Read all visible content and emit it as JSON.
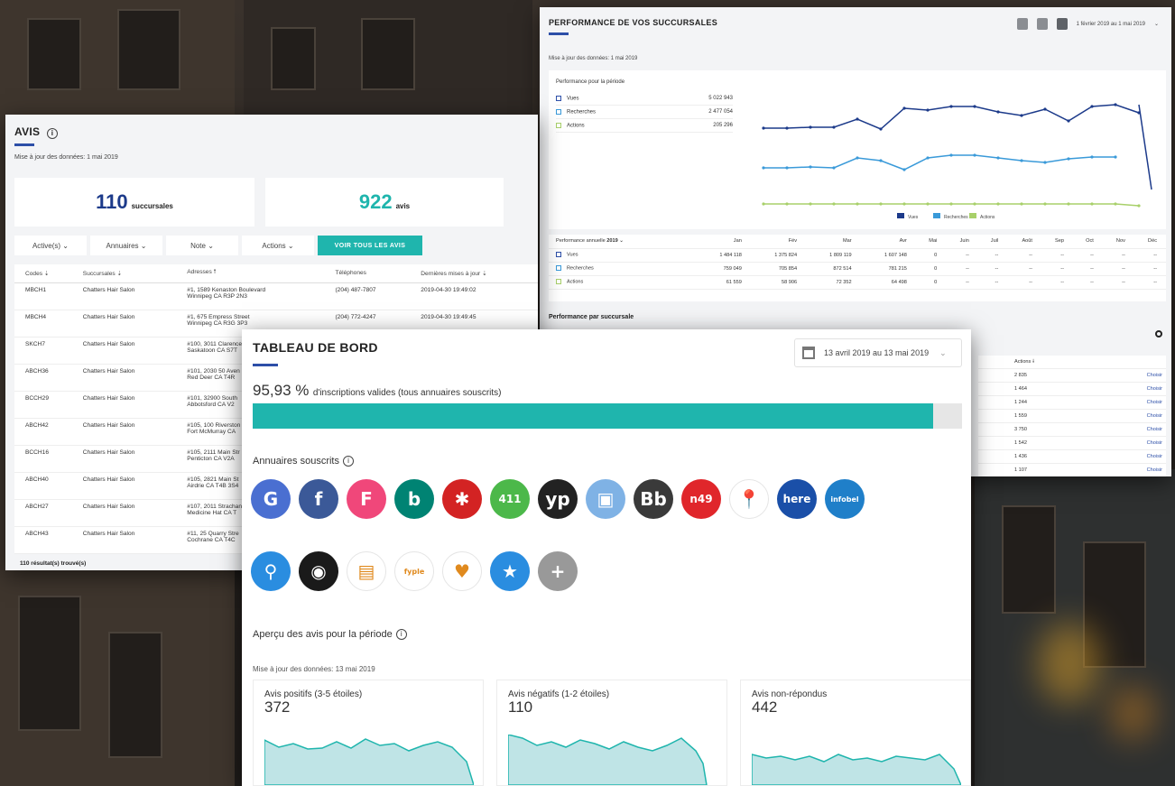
{
  "avis": {
    "title": "AVIS",
    "updated": "Mise à jour des données: 1 mai 2019",
    "stats": [
      {
        "value": "110",
        "label": "succursales",
        "color": "#1c3a8a"
      },
      {
        "value": "922",
        "label": "avis",
        "color": "#1fb5ad"
      }
    ],
    "filters": [
      "Active(s)  ⌄",
      "Annuaires  ⌄",
      "Note  ⌄",
      "Actions  ⌄"
    ],
    "see_all": "VOIR TOUS LES AVIS",
    "columns": [
      "Codes  ⇣",
      "Succursales  ⇣",
      "Adresses  🠕",
      "Téléphones",
      "Dernières mises à jour  ⇣"
    ],
    "rows": [
      {
        "code": "MBCH1",
        "name": "Chatters Hair Salon",
        "addr1": "#1, 1589 Kenaston Boulevard",
        "addr2": "Winnipeg CA R3P 2N3",
        "phone": "(204) 487-7807",
        "date": "2019-04-30 19:49:02"
      },
      {
        "code": "MBCH4",
        "name": "Chatters Hair Salon",
        "addr1": "#1, 675 Empress Street",
        "addr2": "Winnipeg CA R3G 3P3",
        "phone": "(204) 772-4247",
        "date": "2019-04-30 19:49:45"
      },
      {
        "code": "SKCH7",
        "name": "Chatters Hair Salon",
        "addr1": "#100, 3011 Clarence",
        "addr2": "Saskatoon CA S7T",
        "phone": "",
        "date": ""
      },
      {
        "code": "ABCH36",
        "name": "Chatters Hair Salon",
        "addr1": "#101, 2030 50 Aven",
        "addr2": "Red Deer CA T4R",
        "phone": "",
        "date": ""
      },
      {
        "code": "BCCH29",
        "name": "Chatters Hair Salon",
        "addr1": "#101, 32900 South",
        "addr2": "Abbotsford CA V2",
        "phone": "",
        "date": ""
      },
      {
        "code": "ABCH42",
        "name": "Chatters Hair Salon",
        "addr1": "#105, 100 Riverston",
        "addr2": "Fort McMurray CA",
        "phone": "",
        "date": ""
      },
      {
        "code": "BCCH16",
        "name": "Chatters Hair Salon",
        "addr1": "#105, 2111 Main Str",
        "addr2": "Penticton CA V2A",
        "phone": "",
        "date": ""
      },
      {
        "code": "ABCH40",
        "name": "Chatters Hair Salon",
        "addr1": "#105, 2821 Main St",
        "addr2": "Airdrie CA T4B 3S4",
        "phone": "",
        "date": ""
      },
      {
        "code": "ABCH27",
        "name": "Chatters Hair Salon",
        "addr1": "#107, 2011 Strachan",
        "addr2": "Medicine Hat CA T",
        "phone": "",
        "date": ""
      },
      {
        "code": "ABCH43",
        "name": "Chatters Hair Salon",
        "addr1": "#11, 25 Quarry Stre",
        "addr2": "Cochrane CA T4C",
        "phone": "",
        "date": ""
      }
    ],
    "footer": "110 résultat(s) trouvé(s)"
  },
  "perf": {
    "title": "PERFORMANCE DE VOS SUCCURSALES",
    "date_range": "1 février 2019 au 1 mai 2019",
    "updated": "Mise à jour des données: 1 mai 2019",
    "period_label": "Performance pour la période",
    "metrics": [
      {
        "name": "Vues",
        "value": "5 022 943",
        "color": "#2d4fa8"
      },
      {
        "name": "Recherches",
        "value": "2 477 054",
        "color": "#3a9ad9"
      },
      {
        "name": "Actions",
        "value": "205 296",
        "color": "#a8d06a"
      }
    ],
    "legend": [
      "Vues",
      "Recherches",
      "Actions"
    ],
    "annual_label": "Performance annuelle",
    "year": "2019  ⌄",
    "months": [
      "Jan",
      "Fév",
      "Mar",
      "Avr",
      "Mai",
      "Juin",
      "Juil",
      "Août",
      "Sep",
      "Oct",
      "Nov",
      "Déc"
    ],
    "annual_rows": [
      {
        "name": "Vues",
        "vals": [
          "1 484 118",
          "1 375 824",
          "1 809 119",
          "1 607 148",
          "0",
          "--",
          "--",
          "--",
          "--",
          "--",
          "--",
          "--"
        ]
      },
      {
        "name": "Recherches",
        "vals": [
          "759 049",
          "705 854",
          "872 514",
          "781 215",
          "0",
          "--",
          "--",
          "--",
          "--",
          "--",
          "--",
          "--"
        ]
      },
      {
        "name": "Actions",
        "vals": [
          "61 559",
          "58 906",
          "72 352",
          "64 498",
          "0",
          "--",
          "--",
          "--",
          "--",
          "--",
          "--",
          "--"
        ]
      }
    ],
    "by_branch": "Performance par succursale",
    "actions_header": "Actions  🠗",
    "branch_actions": [
      "2 835",
      "1 464",
      "1 244",
      "1 559",
      "3 750",
      "1 542",
      "1 436",
      "1 107"
    ],
    "choose": "Choisir"
  },
  "tdb": {
    "title": "TABLEAU DE BORD",
    "date_range": "13 avril 2019 au 13 mai 2019",
    "pct": "95,93 %",
    "pct_text": "d'inscriptions valides (tous annuaires souscrits)",
    "pct_value": 0.9593,
    "annuaires_title": "Annuaires souscrits",
    "icons_row1": [
      {
        "name": "google-my-business-icon",
        "color": "#4a6fd1",
        "glyph": "G"
      },
      {
        "name": "facebook-icon",
        "color": "#3b5998",
        "glyph": "f"
      },
      {
        "name": "foursquare-icon",
        "color": "#f0477a",
        "glyph": "F"
      },
      {
        "name": "bing-icon",
        "color": "#008373",
        "glyph": "b"
      },
      {
        "name": "yelp-icon",
        "color": "#d32323",
        "glyph": "✱"
      },
      {
        "name": "411-icon",
        "color": "#4cb84a",
        "glyph": "411"
      },
      {
        "name": "yp-icon",
        "color": "#222222",
        "glyph": "yp"
      },
      {
        "name": "canada411-icon",
        "color": "#7fb2e5",
        "glyph": "▣"
      },
      {
        "name": "bb-icon",
        "color": "#3a3a3a",
        "glyph": "Bb"
      },
      {
        "name": "n49-icon",
        "color": "#e0262b",
        "glyph": "n49"
      },
      {
        "name": "cylex-icon",
        "color": "#ffffff",
        "glyph": "📍"
      },
      {
        "name": "here-icon",
        "color": "#1a4fa8",
        "glyph": "here"
      },
      {
        "name": "infobel-icon",
        "color": "#1f7fc9",
        "glyph": "infobel"
      }
    ],
    "icons_row2": [
      {
        "name": "pinpoint-search-icon",
        "color": "#2a8de0",
        "glyph": "⚲"
      },
      {
        "name": "goldenpages-icon",
        "color": "#1a1a1a",
        "glyph": "◉"
      },
      {
        "name": "brownbook-icon",
        "color": "#ffffff",
        "glyph": "▤"
      },
      {
        "name": "fyple-icon",
        "color": "#ffffff",
        "glyph": "fyple"
      },
      {
        "name": "opendi-icon",
        "color": "#ffffff",
        "glyph": "♥"
      },
      {
        "name": "star-icon",
        "color": "#2a8de0",
        "glyph": "★"
      },
      {
        "name": "add-more-icon",
        "color": "#999999",
        "glyph": "+"
      }
    ],
    "apercu_title": "Aperçu des avis pour la période",
    "apercu_updated": "Mise à jour des données: 13 mai 2019",
    "cards": [
      {
        "title": "Avis positifs (3-5 étoiles)",
        "value": "372"
      },
      {
        "title": "Avis négatifs (1-2 étoiles)",
        "value": "110"
      },
      {
        "title": "Avis non-répondus",
        "value": "442"
      }
    ]
  }
}
